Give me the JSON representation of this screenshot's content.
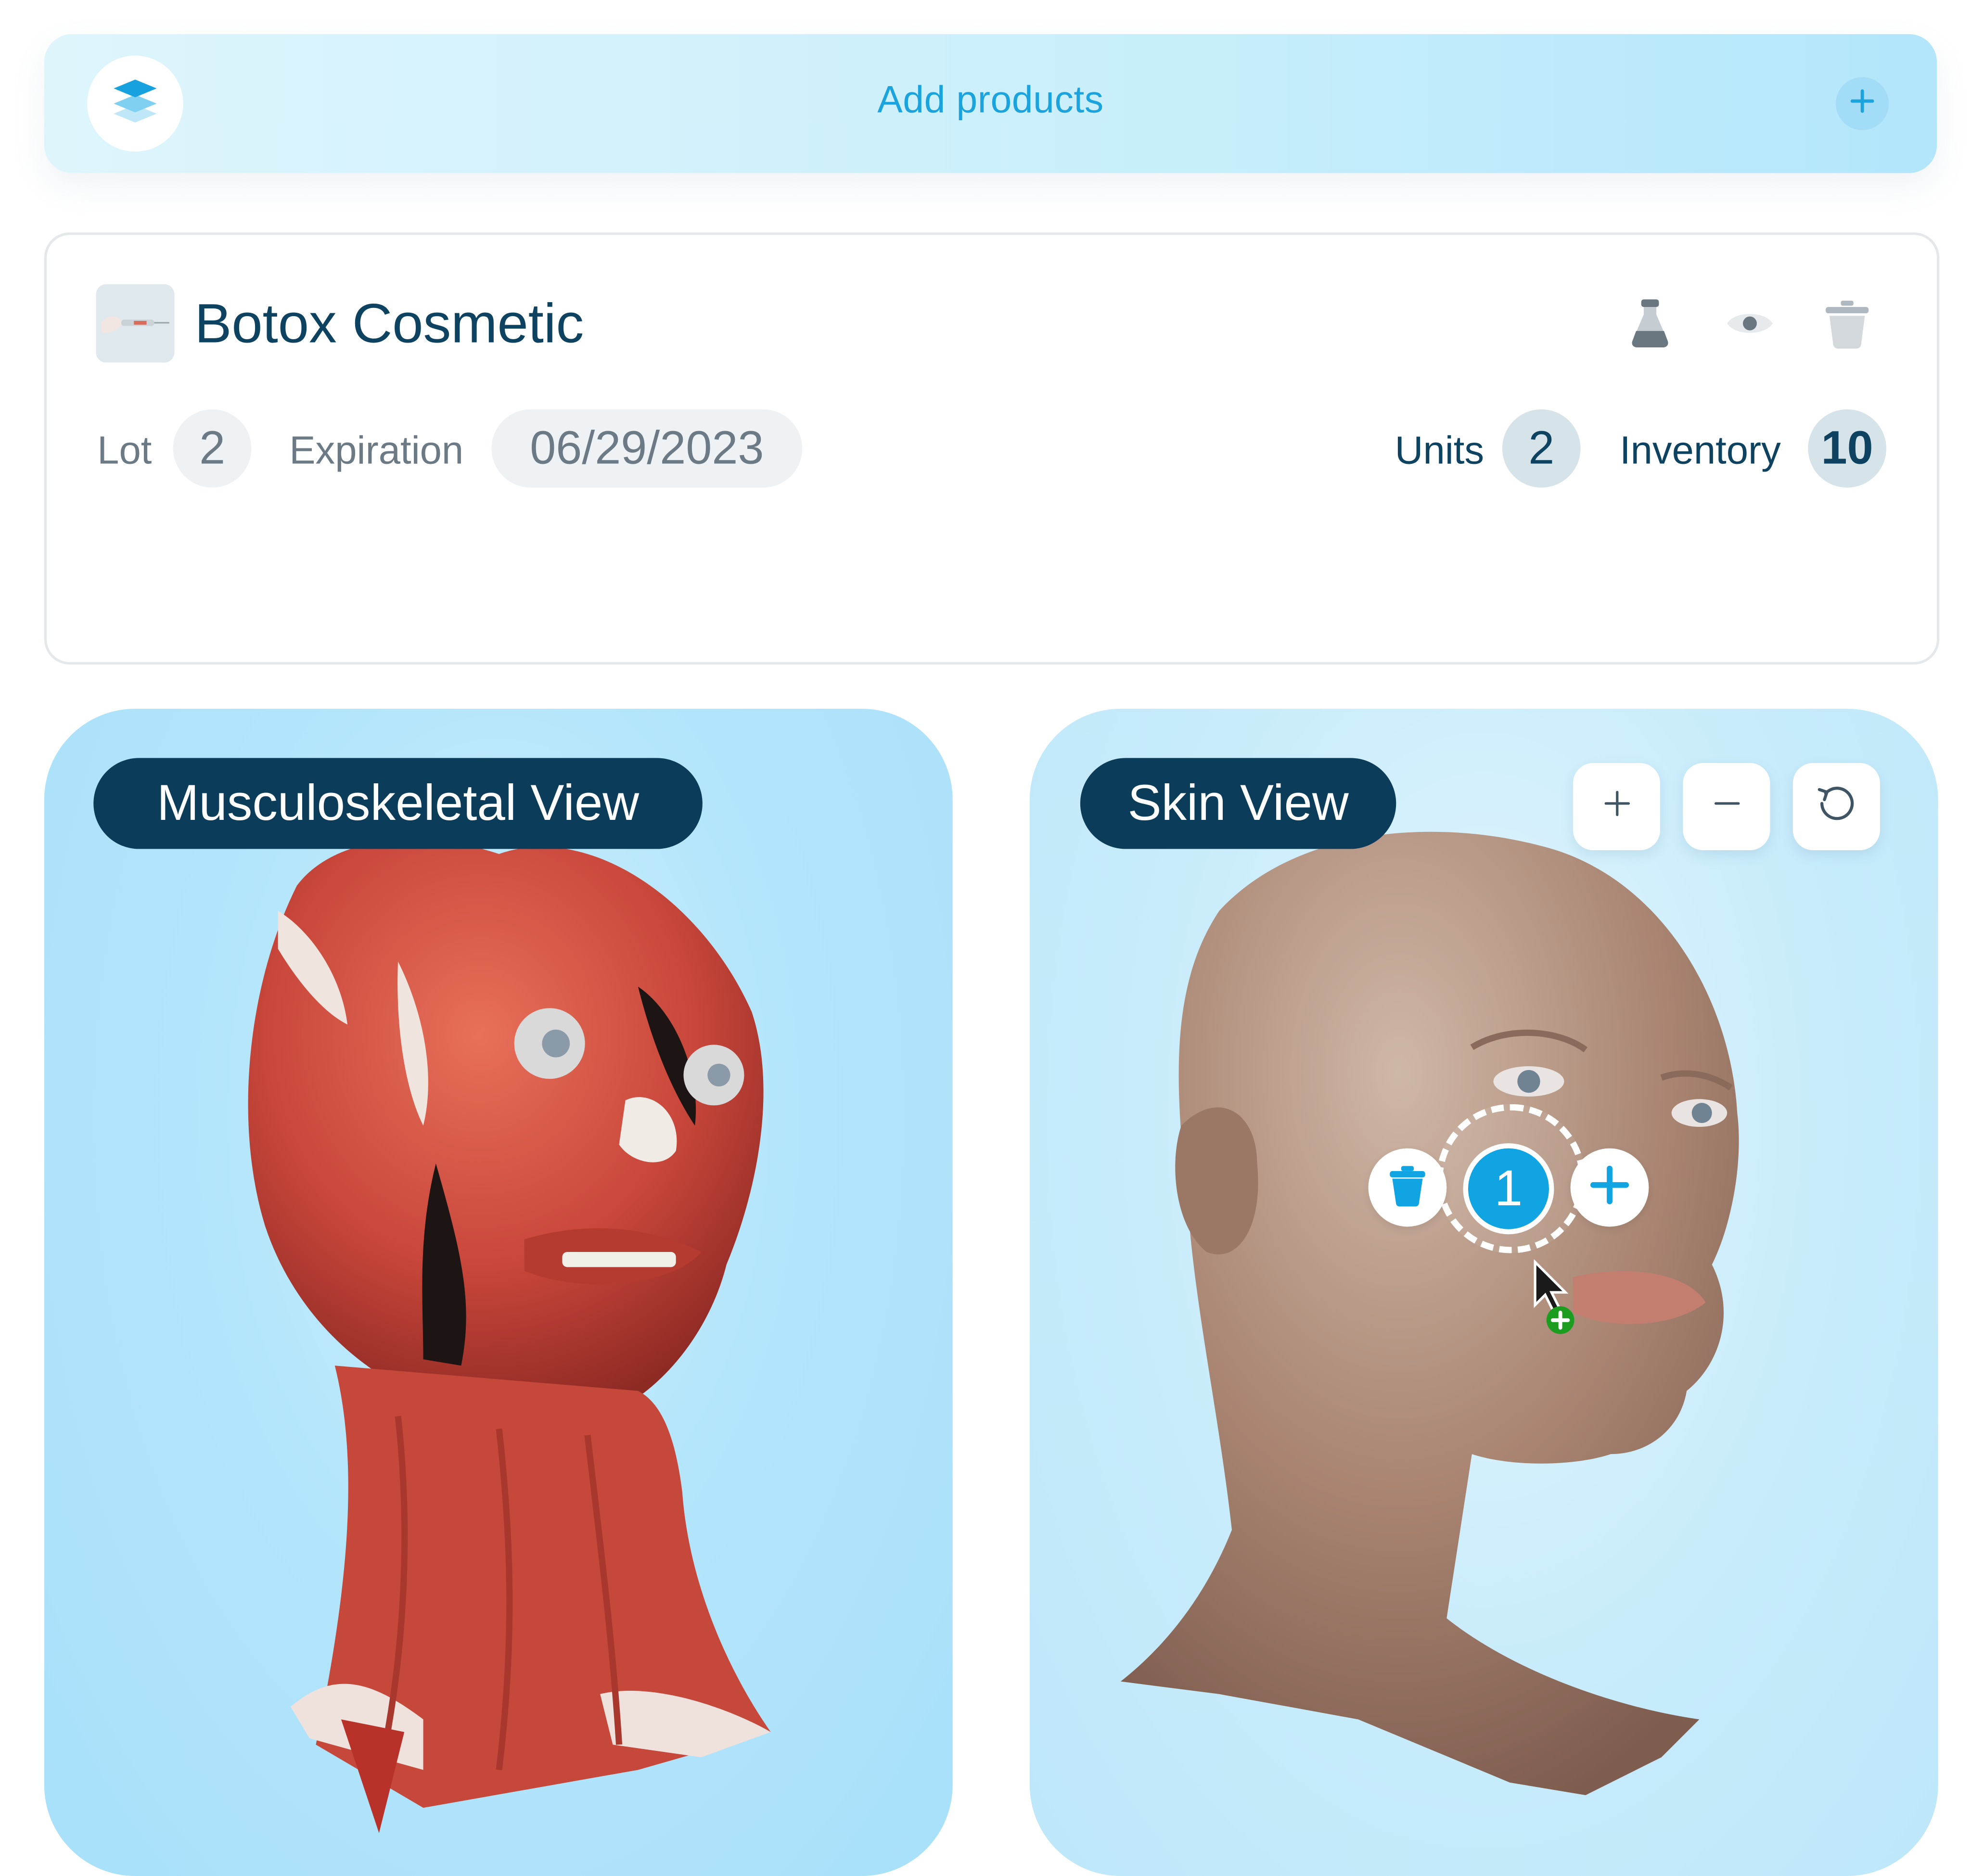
{
  "add_products": {
    "label": "Add products",
    "layers_icon": "layers-icon",
    "add_icon": "plus-icon"
  },
  "product": {
    "name": "Botox Cosmetic",
    "lot_label": "Lot",
    "lot_value": "2",
    "expiration_label": "Expiration",
    "expiration_value": "06/29/2023",
    "units_label": "Units",
    "units_value": "2",
    "inventory_label": "Inventory",
    "inventory_value": "10",
    "actions": [
      "vial-icon",
      "eye-icon",
      "trash-icon"
    ]
  },
  "views": {
    "musculoskeletal_label": "Musculoskeletal View",
    "skin_label": "Skin View",
    "controls": [
      "zoom-in-icon",
      "zoom-out-icon",
      "reset-icon"
    ],
    "marker_number": "1"
  },
  "colors": {
    "accent": "#1ba3dd",
    "navy": "#0b3c5a",
    "marker": "#11a4e3",
    "panel_blue": "#a8e0fa"
  }
}
